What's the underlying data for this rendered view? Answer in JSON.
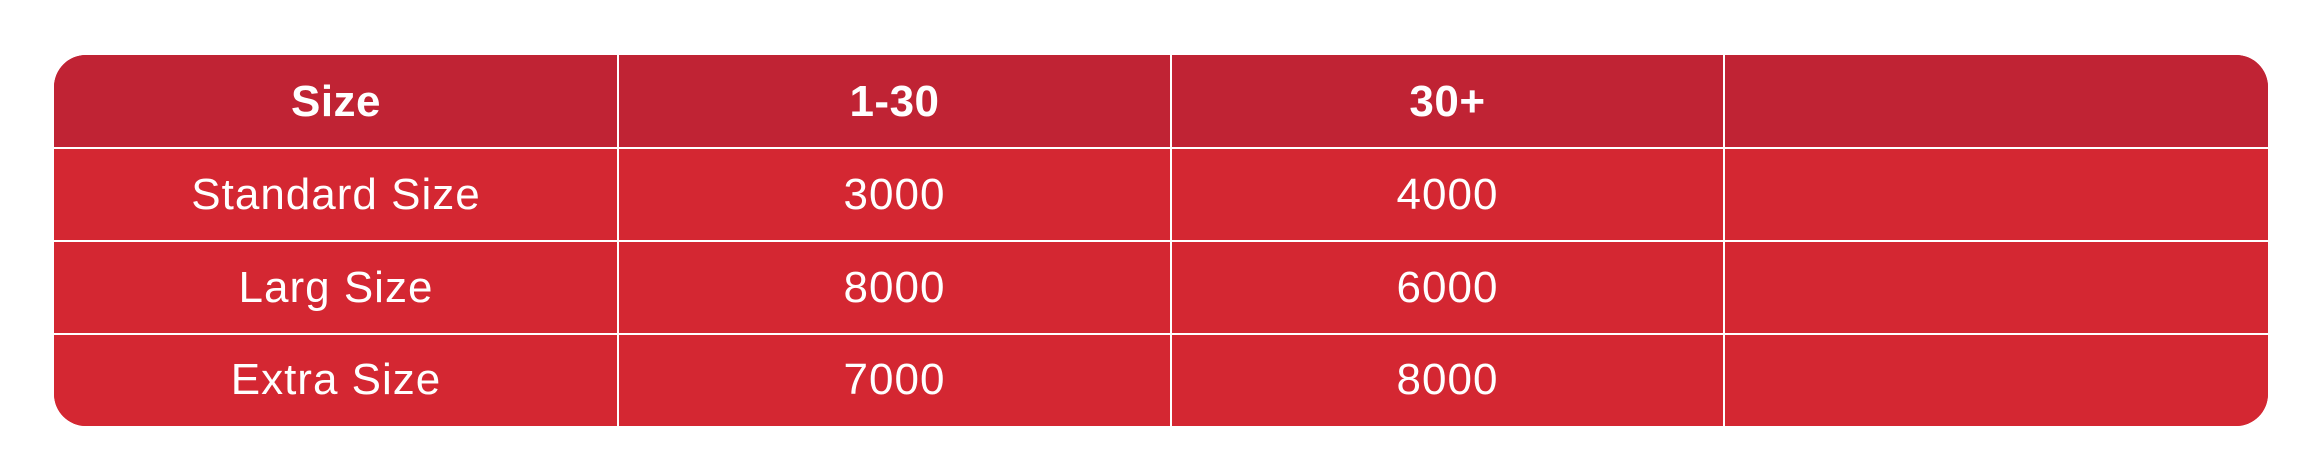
{
  "table": {
    "headers": [
      "Size",
      "1-30",
      "30+",
      ""
    ],
    "rows": [
      [
        "Standard Size",
        "3000",
        "4000",
        ""
      ],
      [
        "Larg Size",
        "8000",
        "6000",
        ""
      ],
      [
        "Extra Size",
        "7000",
        "8000",
        ""
      ]
    ]
  },
  "colors": {
    "header_bg": "#c02334",
    "body_bg": "#d42732",
    "grid": "#ffffff",
    "text": "#ffffff"
  }
}
